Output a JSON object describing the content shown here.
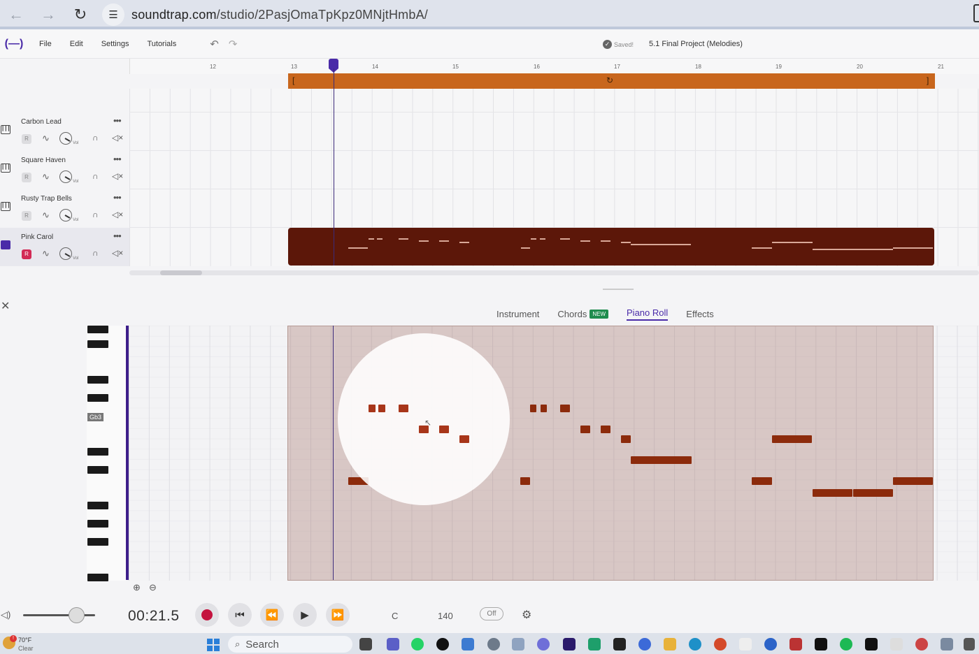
{
  "browser": {
    "back_icon": "arrow-left-icon",
    "forward_icon": "arrow-right-icon",
    "reload_icon": "reload-icon",
    "url_host": "soundtrap.com",
    "url_path": "/studio/2PasjOmaTpKpz0MNjtHmbA/"
  },
  "menu": {
    "logo": "(—)",
    "items": [
      "File",
      "Edit",
      "Settings",
      "Tutorials"
    ],
    "saved_label": "Saved!",
    "project_title": "5.1 Final Project (Melodies)"
  },
  "ruler": {
    "bars": [
      "12",
      "13",
      "14",
      "15",
      "16",
      "17",
      "18",
      "19",
      "20",
      "21"
    ]
  },
  "tracks": [
    {
      "name": "Carbon Lead",
      "rec": "R",
      "vol_label": "Vol",
      "selected": false
    },
    {
      "name": "Square Haven",
      "rec": "R",
      "vol_label": "Vol",
      "selected": false
    },
    {
      "name": "Rusty Trap Bells",
      "rec": "R",
      "vol_label": "Vol",
      "selected": false
    },
    {
      "name": "Pink Carol",
      "rec": "R",
      "vol_label": "Vol",
      "selected": true
    }
  ],
  "editor": {
    "tabs": [
      {
        "label": "Instrument",
        "active": false
      },
      {
        "label": "Chords",
        "badge": "NEW",
        "active": false
      },
      {
        "label": "Piano Roll",
        "active": true
      },
      {
        "label": "Effects",
        "active": false
      }
    ],
    "key_label": "Gb3"
  },
  "transport": {
    "time": "00:21.5",
    "key": "C",
    "bpm": "140",
    "metronome": "Off"
  },
  "taskbar": {
    "temperature": "70°F",
    "condition": "Clear",
    "search_label": "Search"
  },
  "colors": {
    "accent": "#4a2ba8",
    "loop": "#c8661d",
    "clip": "#5c1709",
    "note": "#8c2b0c",
    "record": "#c4133f"
  }
}
